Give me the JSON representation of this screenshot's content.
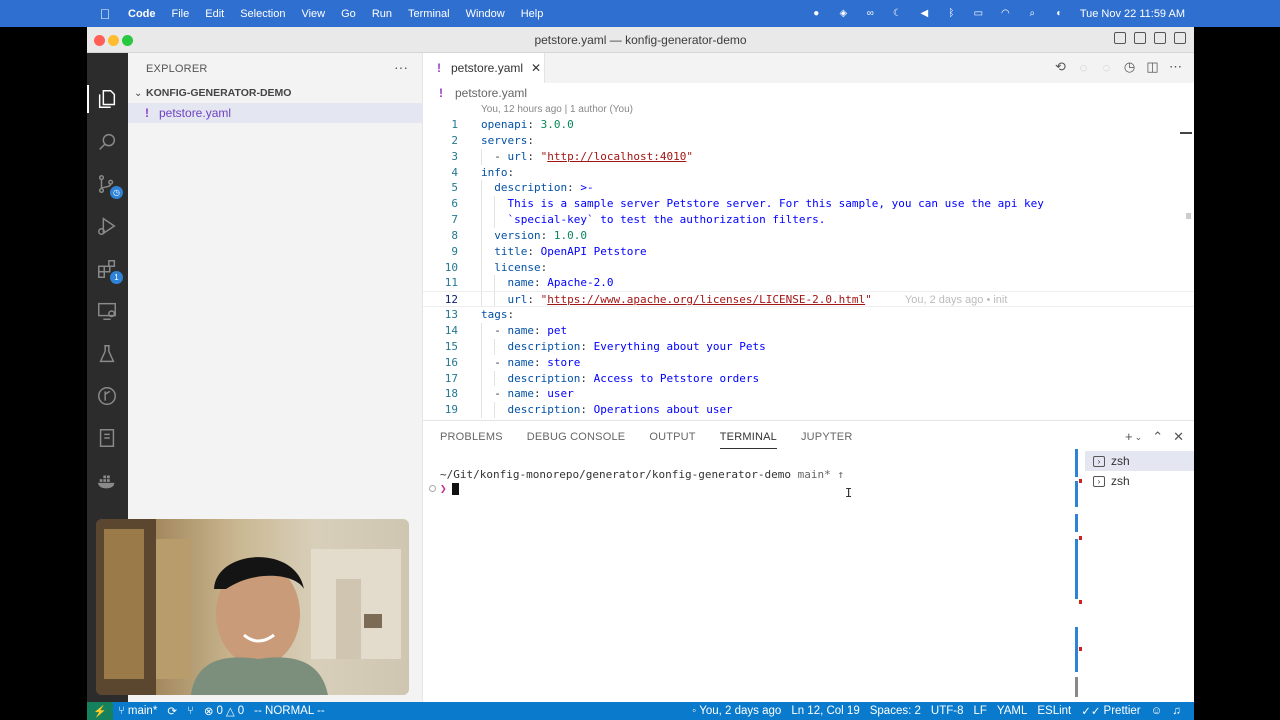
{
  "menubar": {
    "apple": "",
    "items": [
      "Code",
      "File",
      "Edit",
      "Selection",
      "View",
      "Go",
      "Run",
      "Terminal",
      "Window",
      "Help"
    ],
    "datetime": "Tue Nov 22  11:59 AM"
  },
  "window": {
    "title": "petstore.yaml — konfig-generator-demo"
  },
  "sidebar": {
    "title": "EXPLORER",
    "more": "···",
    "folder": "KONFIG-GENERATOR-DEMO",
    "file_icon": "!",
    "file": "petstore.yaml"
  },
  "activity": {
    "extensions_badge": "1"
  },
  "tab": {
    "icon": "!",
    "label": "petstore.yaml",
    "close": "✕"
  },
  "breadcrumb": {
    "icon": "!",
    "label": "petstore.yaml"
  },
  "editor": {
    "blame": "You, 12 hours ago | 1 author (You)",
    "inline_blame": "You, 2 days ago • init",
    "line_numbers": [
      "1",
      "2",
      "3",
      "4",
      "5",
      "6",
      "7",
      "8",
      "9",
      "10",
      "11",
      "12",
      "13",
      "14",
      "15",
      "16",
      "17",
      "18",
      "19"
    ]
  },
  "panel": {
    "tabs": [
      "PROBLEMS",
      "DEBUG CONSOLE",
      "OUTPUT",
      "TERMINAL",
      "JUPYTER"
    ],
    "terminal_path": "~/Git/konfig-monorepo/generator/konfig-generator-demo",
    "terminal_branch": " main* ↑",
    "prompt": "❯",
    "terminals": [
      "zsh",
      "zsh"
    ]
  },
  "statusbar": {
    "remote": "⚡",
    "branch": "main*",
    "errors": "0",
    "warnings": "0",
    "mode": "-- NORMAL --",
    "blame": "You, 2 days ago",
    "position": "Ln 12, Col 19",
    "spaces": "Spaces: 2",
    "encoding": "UTF-8",
    "eol": "LF",
    "language": "YAML",
    "eslint": "ESLint",
    "prettier": "Prettier"
  },
  "colors": {
    "accent": "#0a7acc",
    "activity_bar": "#2c2c2c",
    "menubar": "#2f6fcf",
    "yaml_icon": "#8e3fc7"
  }
}
